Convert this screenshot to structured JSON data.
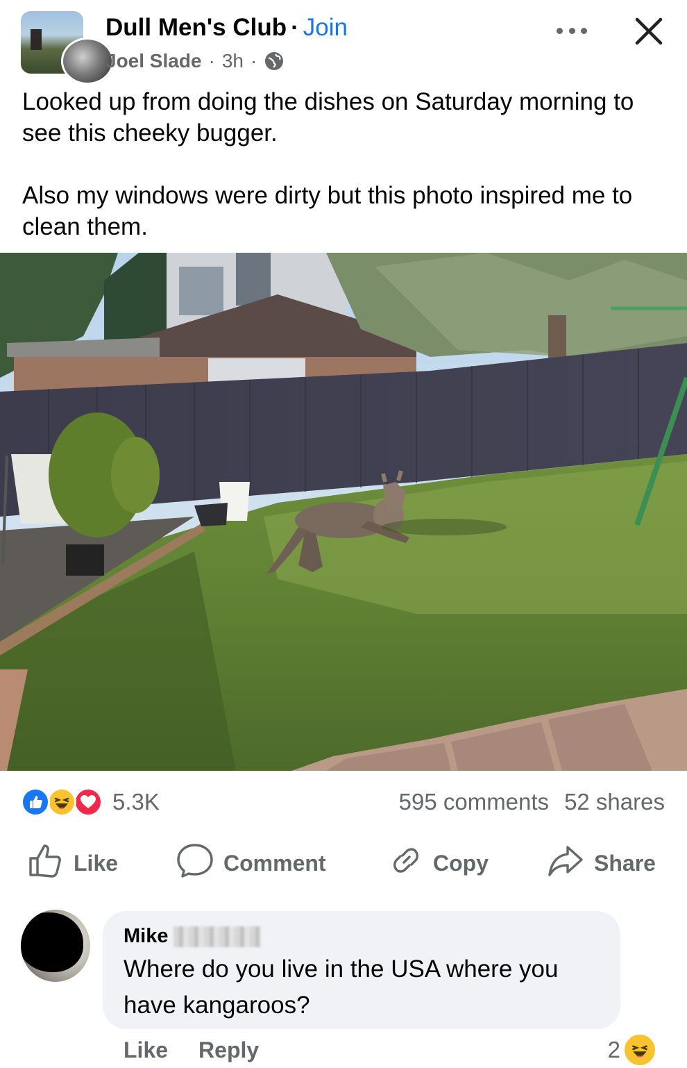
{
  "post": {
    "group_name": "Dull Men's Club",
    "separator": "·",
    "join_label": "Join",
    "author": "Joel Slade",
    "time": "3h",
    "audience_icon": "globe-icon",
    "more_icon": "more-options-icon",
    "close_icon": "close-icon",
    "text_paragraphs": [
      "Looked up from doing the dishes on Saturday morning to see this cheeky bugger.",
      "Also my windows were dirty but this photo inspired me to clean them."
    ]
  },
  "stats": {
    "reaction_icons": [
      "like-reaction-icon",
      "haha-reaction-icon",
      "love-reaction-icon"
    ],
    "reaction_count": "5.3K",
    "comments": "595 comments",
    "shares": "52 shares"
  },
  "actions": {
    "like": "Like",
    "comment": "Comment",
    "copy": "Copy",
    "share": "Share"
  },
  "comment": {
    "author": "Mike",
    "text": "Where do you live in the USA where you have kangaroos?",
    "like": "Like",
    "reply": "Reply",
    "reaction_count": "2"
  },
  "colors": {
    "brand_blue": "#1b74e4",
    "secondary_text": "#65676b",
    "bubble_bg": "#f0f2f5"
  }
}
